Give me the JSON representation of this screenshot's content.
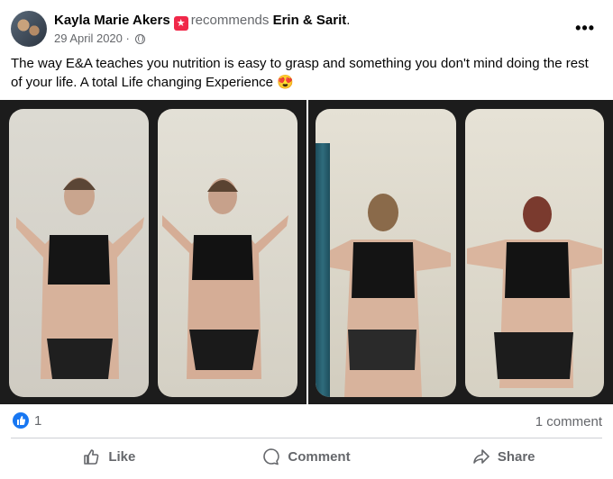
{
  "post": {
    "author": "Kayla Marie Akers",
    "badge_icon": "recommend-star-icon",
    "action_text": "recommends",
    "page_name": "Erin & Sarit",
    "page_suffix": ".",
    "date": "29 April 2020",
    "separator": "·",
    "privacy_icon": "globe-icon",
    "more_icon": "•••",
    "text": "The way E&A teaches you nutrition is easy to grasp and something you don't mind doing the rest of your life. A total Life changing Experience 😍"
  },
  "engagement": {
    "reaction_count": "1",
    "comment_count": "1 comment"
  },
  "actions": {
    "like": "Like",
    "comment": "Comment",
    "share": "Share"
  },
  "colors": {
    "brand_blue": "#1877f2",
    "secondary_text": "#65676b",
    "badge_red": "#f02849"
  }
}
